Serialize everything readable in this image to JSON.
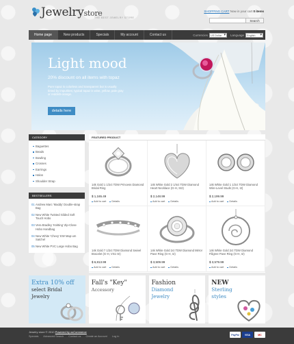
{
  "header": {
    "logo_main": "Jewelry",
    "logo_sub": "store",
    "tagline": "THE BEST JEWELRY STORE",
    "cart_link": "SHOPPING CART",
    "cart_text_pre": "Now in your cart",
    "cart_count": "0 items",
    "search_button": "Search"
  },
  "nav": {
    "items": [
      {
        "label": "Home page"
      },
      {
        "label": "New products"
      },
      {
        "label": "Specials"
      },
      {
        "label": "My account"
      },
      {
        "label": "Contact us"
      }
    ],
    "currencies_label": "Currencies",
    "currencies_value": "US Dollar",
    "language_label": "Language",
    "language_value": "English"
  },
  "banner": {
    "title": "Light mood",
    "subtitle": "20% discount on all items with topaz",
    "description": "Pure topaz is colorless and transparent but is usually tinted by impurities; typical topaz is wine, yellow, pale gray or reddish-orange.",
    "button": "details here"
  },
  "sidebar": {
    "category_head": "CATEGORY",
    "categories": [
      "Baguettes",
      "Beads",
      "Bowling",
      "Crosses",
      "Earrings",
      "Halos",
      "Shoulder Strap"
    ],
    "best_head": "BESTSELLERS",
    "bestsellers": [
      {
        "num": "01",
        "label": "Andrew Marc 'Maddy' Double-strap Bag"
      },
      {
        "num": "02",
        "label": "New White Twisted Gilded Soft Touch Hobo"
      },
      {
        "num": "03",
        "label": "Vera Bradley 'Knitting' Zip-Close Hobo Handbag"
      },
      {
        "num": "04",
        "label": "New White 'Chevy' EW Map-um Satchel"
      },
      {
        "num": "05",
        "label": "New White PVC Large Hobo Bag"
      }
    ]
  },
  "featured": {
    "head": "FEATURED PRODUCT",
    "add_to_cart": "Add to cart",
    "details": "Details",
    "products": [
      {
        "name": "14k Gold 1 1/2ct TDW Princess Diamond Bridal Ring",
        "price": "$ 1,165.49"
      },
      {
        "name": "14k White Gold 2 1/4ct TDW Diamond Heart Necklace (G-H, SI2)",
        "price": "$ 2,148.99"
      },
      {
        "name": "14k White Gold 1 1/2ct TDW Diamond Wire-Level Studs (G-H, I2)",
        "price": "$ 2,199.99"
      },
      {
        "name": "14k Gold 7 1/2ct TDW Diamond Swivel Bracelet (G-H, VS1-SI)",
        "price": "$ 6,813.99"
      },
      {
        "name": "14k White Gold 2ct TDW Diamond Mirror Pave Ring (G-H, I2)",
        "price": "$ 3,509.99"
      },
      {
        "name": "14k White Gold 2ct TDW Diamond Filigree Pave Ring (G-H, I2)",
        "price": "$ 3,579.99"
      }
    ]
  },
  "promos": [
    {
      "lines": [
        "Extra 10% off",
        "select Bridal",
        "Jewelry"
      ]
    },
    {
      "lines": [
        "Fall's \"Key\"",
        "Accessory"
      ]
    },
    {
      "lines": [
        "Fashion",
        "Diamond",
        "Jewelry"
      ]
    },
    {
      "lines": [
        "NEW",
        "Sterling",
        "styles"
      ]
    }
  ],
  "footer": {
    "copy_pre": "Jewelry store © 2010",
    "copy_link": "Powered by osCommerce",
    "links": [
      "Specials",
      "Advanced Search",
      "Contact us",
      "Create an Account",
      "Log In"
    ],
    "payments": [
      "PayPal",
      "VISA",
      "MC"
    ]
  },
  "colors": {
    "accent": "#2a7ac0",
    "nav_bg": "#3b3b3b",
    "banner_button": "#3f8cc4"
  }
}
